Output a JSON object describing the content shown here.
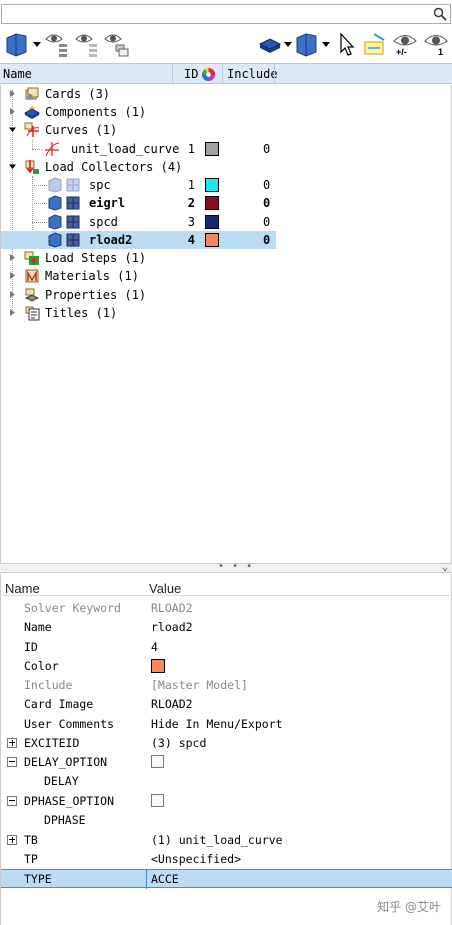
{
  "search": {
    "placeholder": "",
    "icon": "magnifier-icon"
  },
  "toolbar": {
    "left_icons": [
      "display-mode-icon",
      "show-eye-tree-icon",
      "hide-eye-tree-icon",
      "isolate-eye-tree-icon"
    ],
    "right_icons": [
      "component-display-icon",
      "collector-display-icon",
      "select-cursor-icon",
      "highlight-icon",
      "show-hide-eye-icon",
      "isolate-eye-icon"
    ],
    "eye_plusminus_label": "+/-",
    "eye_one_label": "1"
  },
  "tree_header": {
    "name": "Name",
    "id": "ID",
    "include": "Include"
  },
  "tree": {
    "rows": [
      {
        "label": "Cards (3)",
        "id": "",
        "include": "",
        "icon": "cards-icon"
      },
      {
        "label": "Components (1)",
        "id": "",
        "include": "",
        "icon": "components-icon"
      },
      {
        "label": "Curves (1)",
        "id": "",
        "include": "",
        "icon": "curves-icon"
      },
      {
        "label": "unit_load_curve",
        "id": "1",
        "include": "0",
        "color": "#a0a0a0",
        "icon": "curve-icon"
      },
      {
        "label": "Load Collectors (4)",
        "id": "",
        "include": "",
        "icon": "load-collectors-icon"
      },
      {
        "label": "spc",
        "id": "1",
        "include": "0",
        "color": "#22e6ef",
        "icon": "load-collector-icon"
      },
      {
        "label": "eigrl",
        "id": "2",
        "include": "0",
        "color": "#8b0e1d",
        "icon": "load-collector-icon"
      },
      {
        "label": "spcd",
        "id": "3",
        "include": "0",
        "color": "#142a6e",
        "icon": "load-collector-icon"
      },
      {
        "label": "rload2",
        "id": "4",
        "include": "0",
        "color": "#f4875e",
        "icon": "load-collector-icon"
      },
      {
        "label": "Load Steps (1)",
        "id": "",
        "include": "",
        "icon": "load-steps-icon"
      },
      {
        "label": "Materials (1)",
        "id": "",
        "include": "",
        "icon": "materials-icon"
      },
      {
        "label": "Properties (1)",
        "id": "",
        "include": "",
        "icon": "properties-icon"
      },
      {
        "label": "Titles (1)",
        "id": "",
        "include": "",
        "icon": "titles-icon"
      }
    ]
  },
  "props_header": {
    "name": "Name",
    "value": "Value"
  },
  "props": [
    {
      "name": "Solver Keyword",
      "value": "RLOAD2",
      "gray": true
    },
    {
      "name": "Name",
      "value": "rload2"
    },
    {
      "name": "ID",
      "value": "4"
    },
    {
      "name": "Color",
      "value": "",
      "color": "#f4875e"
    },
    {
      "name": "Include",
      "value": "[Master Model]",
      "gray": true
    },
    {
      "name": "Card Image",
      "value": "RLOAD2"
    },
    {
      "name": "User Comments",
      "value": "Hide In Menu/Export"
    },
    {
      "name": "EXCITEID",
      "value": "(3) spcd"
    },
    {
      "name": "DELAY_OPTION",
      "value": ""
    },
    {
      "name": "DELAY",
      "value": ""
    },
    {
      "name": "DPHASE_OPTION",
      "value": ""
    },
    {
      "name": "DPHASE",
      "value": ""
    },
    {
      "name": "TB",
      "value": "(1) unit_load_curve"
    },
    {
      "name": "TP",
      "value": "<Unspecified>"
    },
    {
      "name": "TYPE",
      "value": "ACCE"
    }
  ],
  "watermark": "知乎 @艾叶"
}
